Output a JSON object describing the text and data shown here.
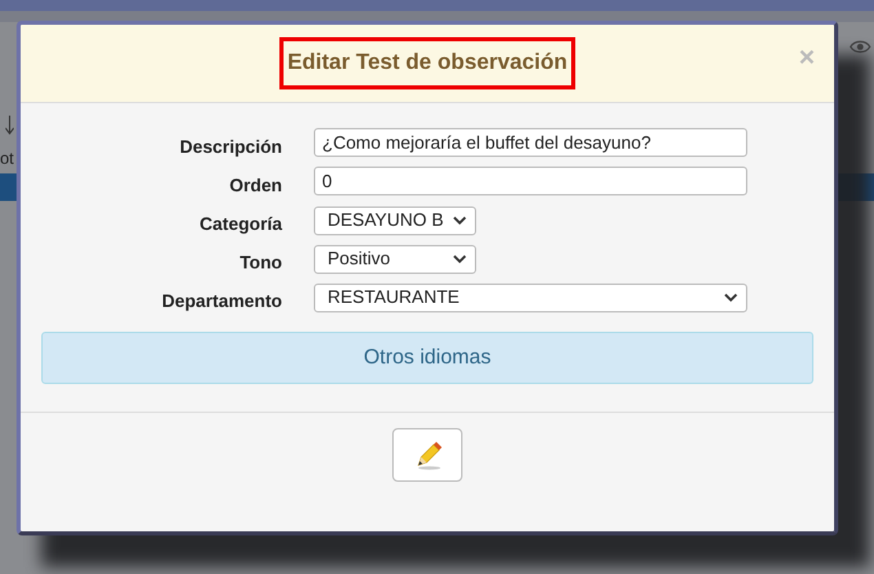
{
  "background": {
    "row_text": "ot"
  },
  "dialog": {
    "title": "Editar Test de observación",
    "title_highlighted": true,
    "close": "×",
    "fields": [
      {
        "label": "Descripción",
        "kind": "text",
        "value": "¿Como mejoraría el buffet del desayuno?"
      },
      {
        "label": "Orden",
        "kind": "text",
        "value": "0"
      },
      {
        "label": "Categoría",
        "kind": "select-short",
        "value": "DESAYUNO B"
      },
      {
        "label": "Tono",
        "kind": "select-short",
        "value": "Positivo"
      },
      {
        "label": "Departamento",
        "kind": "select-wide",
        "value": "RESTAURANTE"
      }
    ],
    "panel": "Otros idiomas"
  }
}
